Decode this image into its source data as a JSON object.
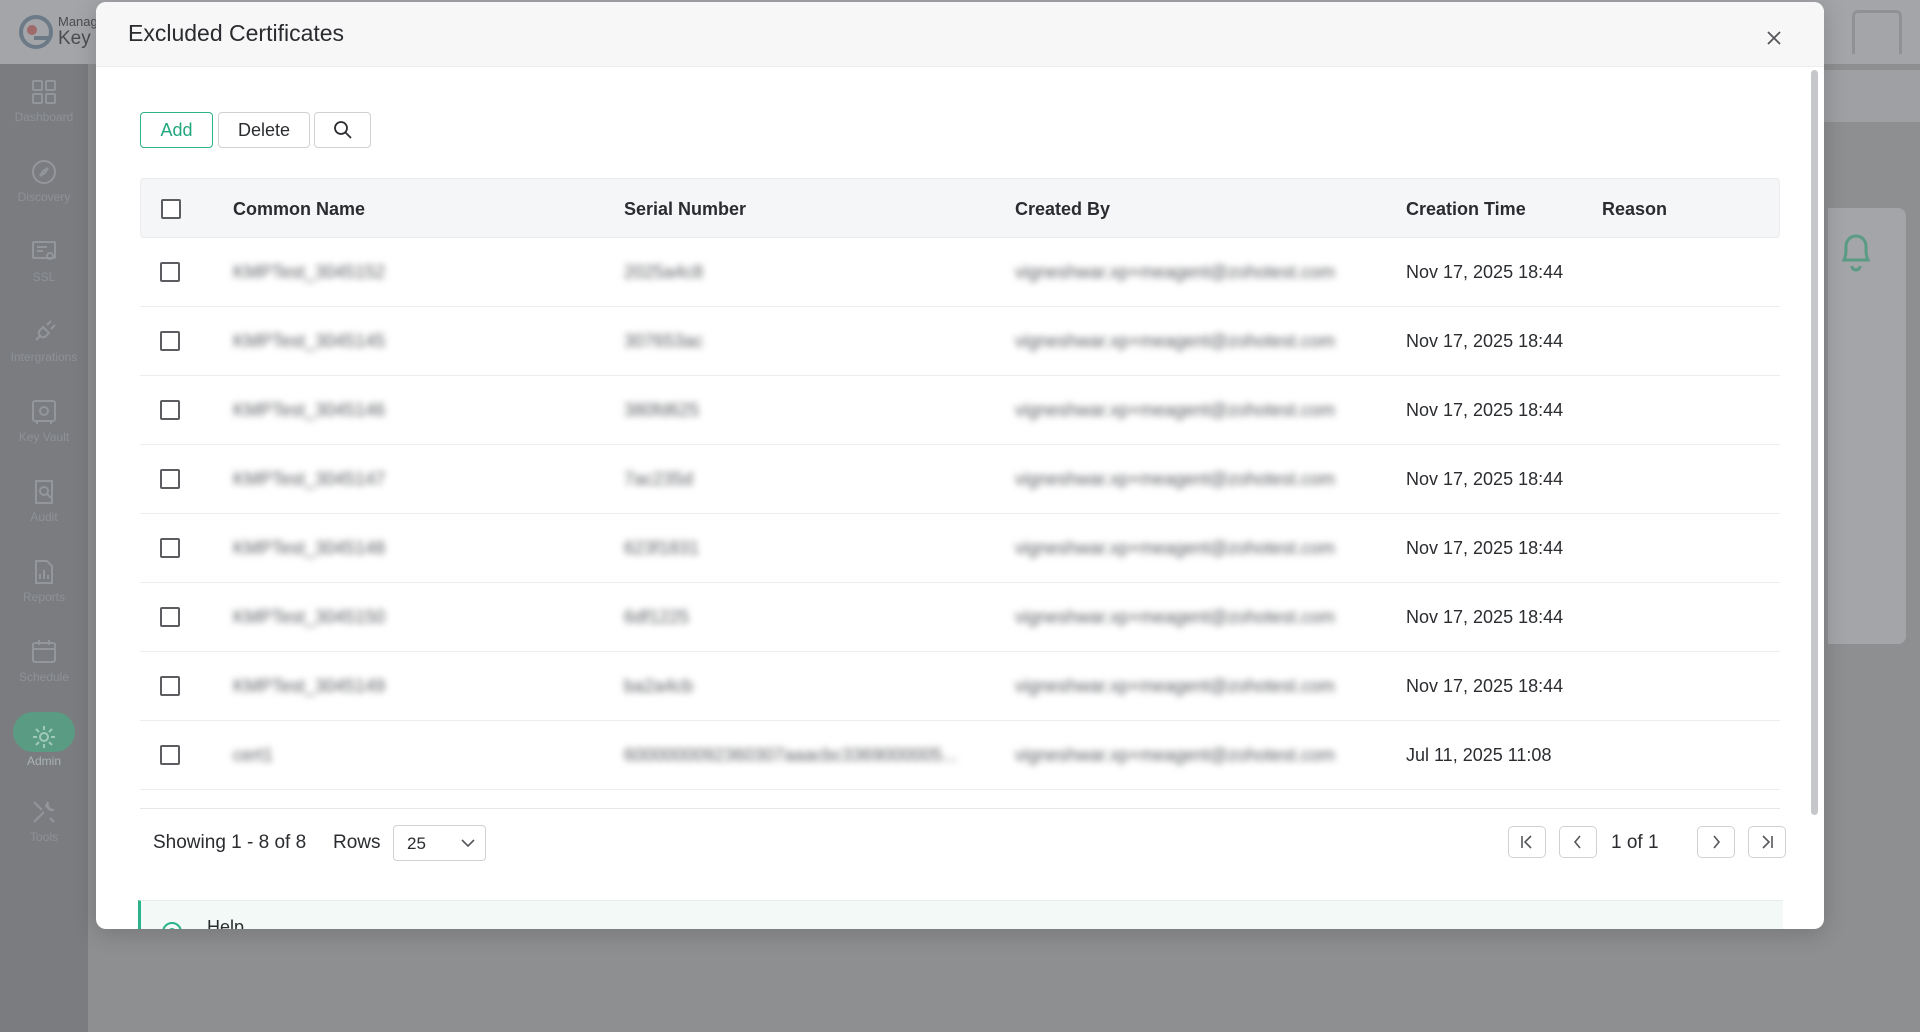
{
  "app": {
    "title_line1": "Manag",
    "title_line2": "Key M"
  },
  "sidebar": {
    "items": [
      {
        "label": "Dashboard",
        "icon": "dashboard-icon"
      },
      {
        "label": "Discovery",
        "icon": "compass-icon"
      },
      {
        "label": "SSL",
        "icon": "ssl-certificate-icon"
      },
      {
        "label": "Intergrations",
        "icon": "plug-icon"
      },
      {
        "label": "Key Vault",
        "icon": "vault-icon"
      },
      {
        "label": "Audit",
        "icon": "audit-icon"
      },
      {
        "label": "Reports",
        "icon": "reports-icon"
      },
      {
        "label": "Schedule",
        "icon": "calendar-icon"
      },
      {
        "label": "Admin",
        "icon": "gear-icon",
        "active": true
      },
      {
        "label": "Tools",
        "icon": "tools-icon"
      }
    ]
  },
  "modal": {
    "title": "Excluded Certificates",
    "toolbar": {
      "add_label": "Add",
      "delete_label": "Delete"
    },
    "columns": [
      "Common Name",
      "Serial Number",
      "Created By",
      "Creation Time",
      "Reason"
    ],
    "rows": [
      {
        "common_name": "KMPTest_3045152",
        "serial": "2025a4c8",
        "created_by": "vigneshwar.xp+meagent@zohotest.com",
        "creation_time": "Nov 17, 2025 18:44",
        "reason": ""
      },
      {
        "common_name": "KMPTest_3045145",
        "serial": "307653ac",
        "created_by": "vigneshwar.xp+meagent@zohotest.com",
        "creation_time": "Nov 17, 2025 18:44",
        "reason": ""
      },
      {
        "common_name": "KMPTest_3045146",
        "serial": "380fd625",
        "created_by": "vigneshwar.xp+meagent@zohotest.com",
        "creation_time": "Nov 17, 2025 18:44",
        "reason": ""
      },
      {
        "common_name": "KMPTest_3045147",
        "serial": "7ac235d",
        "created_by": "vigneshwar.xp+meagent@zohotest.com",
        "creation_time": "Nov 17, 2025 18:44",
        "reason": ""
      },
      {
        "common_name": "KMPTest_3045148",
        "serial": "623f1831",
        "created_by": "vigneshwar.xp+meagent@zohotest.com",
        "creation_time": "Nov 17, 2025 18:44",
        "reason": ""
      },
      {
        "common_name": "KMPTest_3045150",
        "serial": "6df1225",
        "created_by": "vigneshwar.xp+meagent@zohotest.com",
        "creation_time": "Nov 17, 2025 18:44",
        "reason": ""
      },
      {
        "common_name": "KMPTest_3045149",
        "serial": "ba2a4cb",
        "created_by": "vigneshwar.xp+meagent@zohotest.com",
        "creation_time": "Nov 17, 2025 18:44",
        "reason": ""
      },
      {
        "common_name": "cert1",
        "serial": "6000000092360307aaacbc3369000005...",
        "created_by": "vigneshwar.xp+meagent@zohotest.com",
        "creation_time": "Jul 11, 2025 11:08",
        "reason": ""
      }
    ],
    "pagination": {
      "showing": "Showing 1 - 8 of 8",
      "rows_label": "Rows",
      "rows_value": "25",
      "page_text": "1 of 1"
    },
    "help": {
      "label": "Help"
    }
  },
  "colors": {
    "accent": "#2bb38a",
    "overlay": "#8e8f91",
    "sidebar_active": "#5a9b84"
  }
}
